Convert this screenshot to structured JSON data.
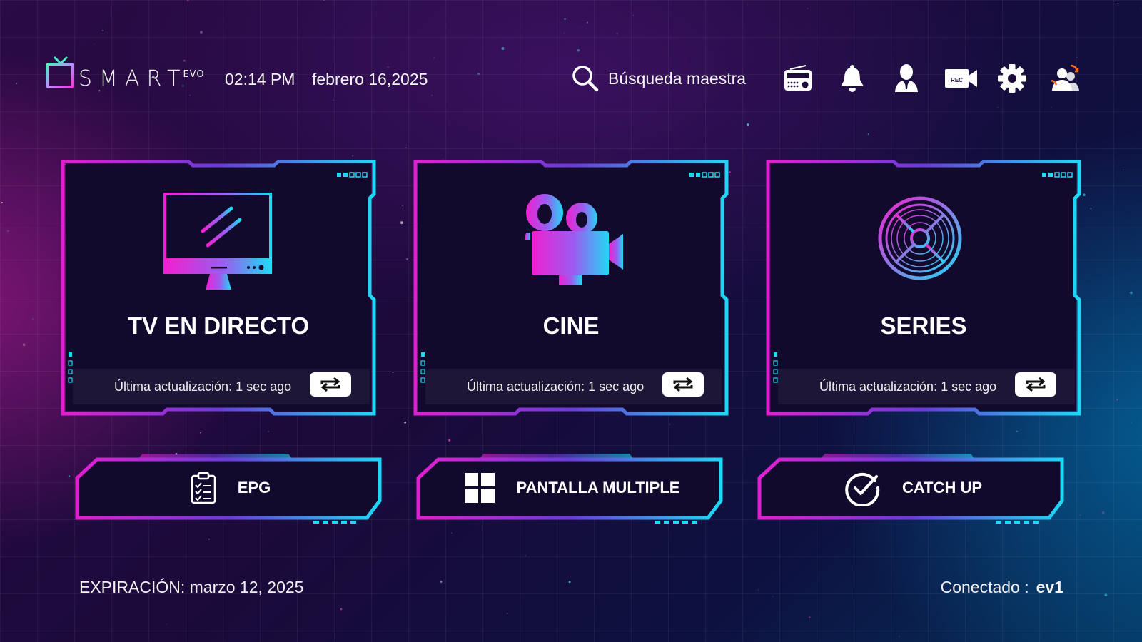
{
  "header": {
    "logo_text": "SMART",
    "logo_suffix": "EVO",
    "time": "02:14 PM",
    "date": "febrero 16,2025",
    "search_label": "Búsqueda maestra",
    "icons": [
      "radio-icon",
      "bell-icon",
      "user-icon",
      "rec-camera-icon",
      "gear-icon",
      "switch-user-icon"
    ],
    "rec_badge": "REC"
  },
  "cards": [
    {
      "title": "TV EN DIRECTO",
      "icon": "tv-icon",
      "update_text": "Última actualización: 1 sec ago"
    },
    {
      "title": "CINE",
      "icon": "movie-camera-icon",
      "update_text": "Última actualización: 1 sec ago"
    },
    {
      "title": "SERIES",
      "icon": "film-reel-icon",
      "update_text": "Última actualización: 1 sec ago"
    }
  ],
  "buttons": [
    {
      "label": "EPG",
      "icon": "clipboard-checklist-icon"
    },
    {
      "label": "PANTALLA MULTIPLE",
      "icon": "grid-icon"
    },
    {
      "label": "CATCH UP",
      "icon": "check-circle-icon"
    }
  ],
  "footer": {
    "expiration": "EXPIRACIÓN: marzo 12, 2025",
    "connected_label": "Conectado :",
    "connected_value": "ev1"
  },
  "colors": {
    "accent_pink": "#e21fd0",
    "accent_cyan": "#1ed8f5",
    "card_bg": "#120a2c"
  }
}
